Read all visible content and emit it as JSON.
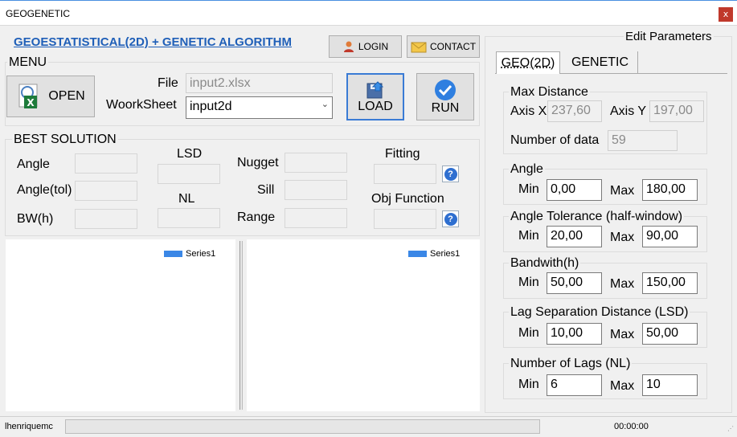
{
  "window": {
    "title": "GEOGENETIC",
    "close_label": "x"
  },
  "header": {
    "app_title": "GEOESTATISTICAL(2D) + GENETIC ALGORITHM",
    "login_label": "LOGIN",
    "contact_label": "CONTACT"
  },
  "menu": {
    "title": "MENU",
    "open_label": "OPEN",
    "file_label": "File",
    "file_value": "input2.xlsx",
    "worksheet_label": "WoorkSheet",
    "worksheet_value": "input2d",
    "load_label": "LOAD",
    "run_label": "RUN"
  },
  "best_solution": {
    "title": "BEST SOLUTION",
    "angle_label": "Angle",
    "angle_tol_label": "Angle(tol)",
    "bw_label": "BW(h)",
    "lsd_label": "LSD",
    "nl_label": "NL",
    "nugget_label": "Nugget",
    "sill_label": "Sill",
    "range_label": "Range",
    "fitting_label": "Fitting",
    "obj_function_label": "Obj Function"
  },
  "charts": {
    "left": {
      "legend": "Series1"
    },
    "right": {
      "legend": "Series1"
    }
  },
  "edit_params": {
    "title": "Edit Parameters",
    "tabs": [
      {
        "label": "GEO(2D)",
        "active": true
      },
      {
        "label": "GENETIC",
        "active": false
      }
    ],
    "max_distance": {
      "title": "Max Distance",
      "axis_x_label": "Axis X",
      "axis_x_value": "237,60",
      "axis_y_label": "Axis Y",
      "axis_y_value": "197,00",
      "num_data_label": "Number of data",
      "num_data_value": "59"
    },
    "angle": {
      "title": "Angle",
      "min_label": "Min",
      "min_value": "0,00",
      "max_label": "Max",
      "max_value": "180,00"
    },
    "angle_tol": {
      "title": "Angle Tolerance (half-window)",
      "min_label": "Min",
      "min_value": "20,00",
      "max_label": "Max",
      "max_value": "90,00"
    },
    "bandwidth": {
      "title": "Bandwith(h)",
      "min_label": "Min",
      "min_value": "50,00",
      "max_label": "Max",
      "max_value": "150,00"
    },
    "lsd": {
      "title": "Lag Separation Distance (LSD)",
      "min_label": "Min",
      "min_value": "10,00",
      "max_label": "Max",
      "max_value": "50,00"
    },
    "nl": {
      "title": "Number of Lags (NL)",
      "min_label": "Min",
      "min_value": "6",
      "max_label": "Max",
      "max_value": "10"
    }
  },
  "status": {
    "user": "lhenriquemc",
    "time": "00:00:00"
  },
  "colors": {
    "accent": "#1f5fb8",
    "legend": "#3a87e6",
    "help": "#2e6fd0"
  }
}
